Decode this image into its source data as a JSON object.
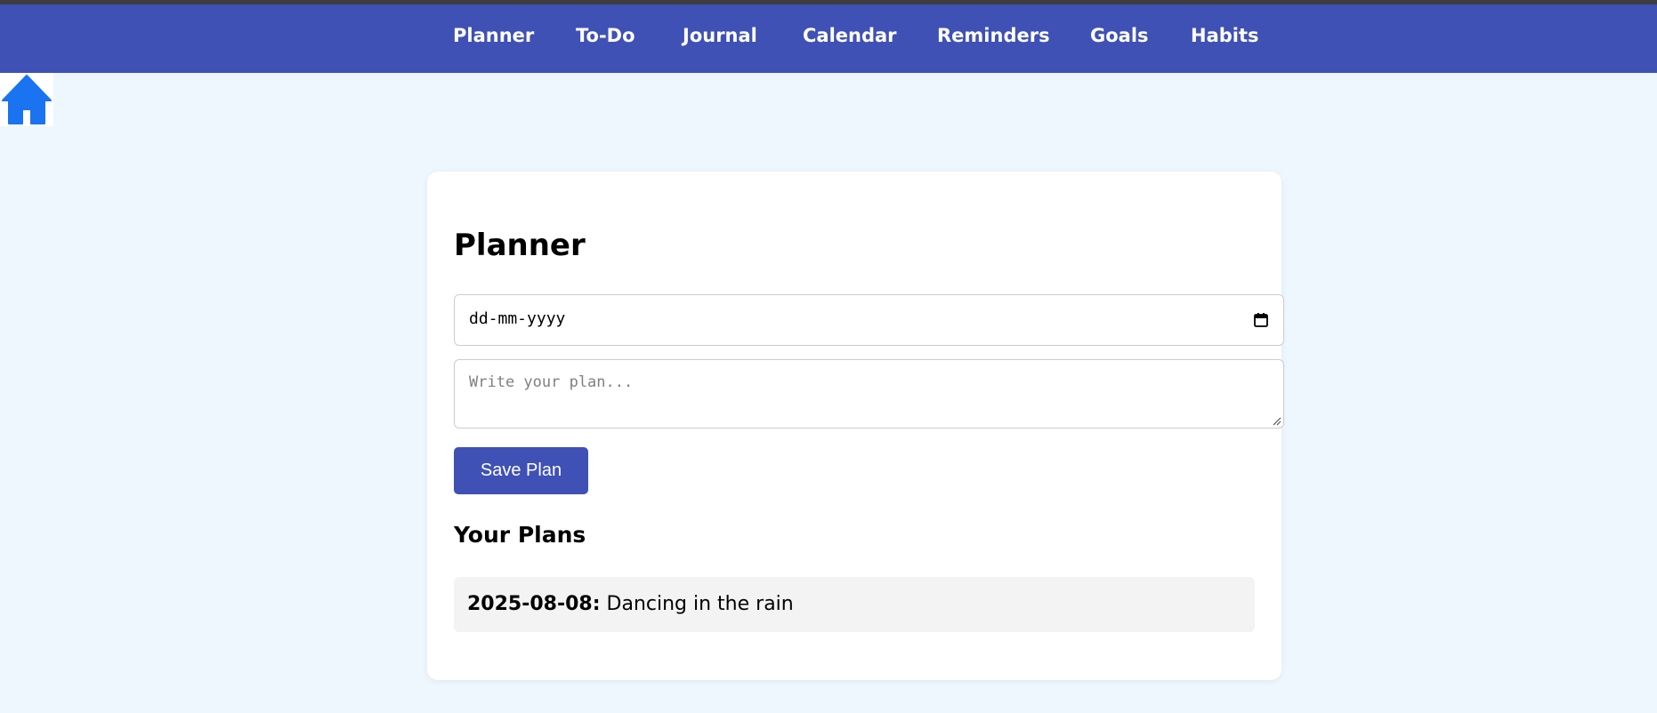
{
  "nav": {
    "items": [
      {
        "label": "Planner"
      },
      {
        "label": "To-Do"
      },
      {
        "label": "Journal"
      },
      {
        "label": "Calendar"
      },
      {
        "label": "Reminders"
      },
      {
        "label": "Goals"
      },
      {
        "label": "Habits"
      }
    ]
  },
  "home": {
    "icon": "home-icon"
  },
  "planner": {
    "title": "Planner",
    "date_input": {
      "value": "dd-mm-yyyy",
      "icon": "calendar-icon"
    },
    "plan_textarea": {
      "placeholder": "Write your plan...",
      "value": ""
    },
    "save_button_label": "Save Plan"
  },
  "plans": {
    "heading": "Your Plans",
    "items": [
      {
        "date": "2025-08-08:",
        "text": "Dancing in the rain"
      }
    ]
  },
  "colors": {
    "navbar": "#3f51b5",
    "page_background": "#eef6fe",
    "home_icon": "#1a73f0",
    "button": "#3f51b5",
    "plan_item_background": "#f3f3f3"
  }
}
